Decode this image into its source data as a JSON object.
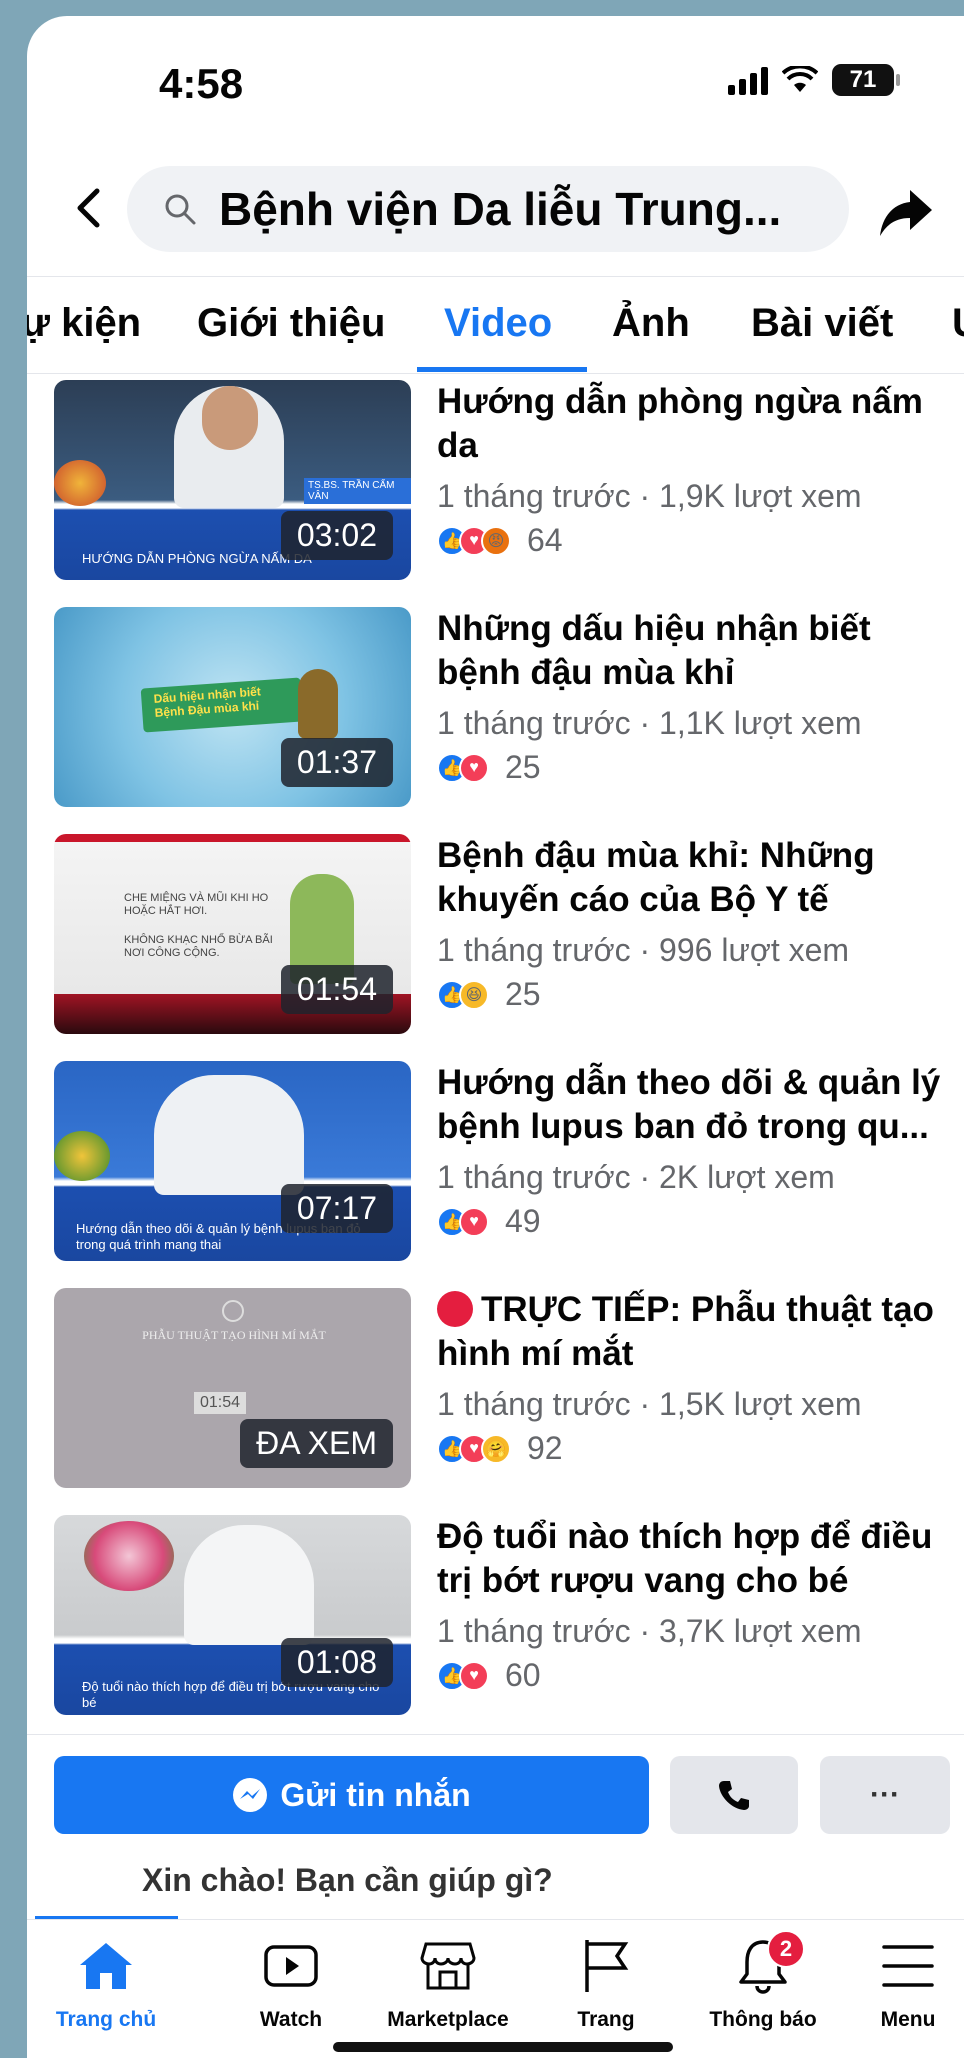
{
  "status": {
    "time": "4:58",
    "battery": "71"
  },
  "header": {
    "search_query": "Bệnh viện Da liễu Trung..."
  },
  "tabs": [
    {
      "label": "ự kiện"
    },
    {
      "label": "Giới thiệu"
    },
    {
      "label": "Video"
    },
    {
      "label": "Ảnh"
    },
    {
      "label": "Bài viết"
    },
    {
      "label": "U"
    }
  ],
  "videos": [
    {
      "title": "Hướng dẫn phòng ngừa nấm da",
      "meta": "1 tháng trước · 1,9K lượt xem",
      "reactions": "64",
      "duration": "03:02",
      "thumb_caption": "HƯỚNG DẪN PHÒNG NGỪA NẤM DA",
      "thumb_name_tag": "TS.BS. TRẦN CẨM VÂN"
    },
    {
      "title": "Những dấu hiệu nhận biết bệnh đậu mùa khỉ",
      "meta": "1 tháng trước · 1,1K lượt xem",
      "reactions": "25",
      "duration": "01:37",
      "thumb_caption": "Dấu hiệu nhận biết Bệnh Đậu mùa khỉ"
    },
    {
      "title": "Bệnh đậu mùa khỉ: Những khuyến cáo của Bộ Y tế",
      "meta": "1 tháng trước · 996 lượt xem",
      "reactions": "25",
      "duration": "01:54",
      "thumb_caption": "CHE MIỆNG VÀ MŨI KHI HO HOẶC HẮT HƠI.",
      "thumb_caption2": "KHÔNG KHẠC NHỔ BỪA BÃI NƠI CÔNG CỘNG."
    },
    {
      "title": "Hướng dẫn theo dõi & quản lý bệnh lupus ban đỏ trong qu...",
      "meta": "1 tháng trước · 2K lượt xem",
      "reactions": "49",
      "duration": "07:17",
      "thumb_caption": "Hướng dẫn theo dõi & quản lý bệnh lupus ban đỏ trong quá trình mang thai"
    },
    {
      "title": "TRỰC TIẾP: Phẫu thuật tạo hình mí mắt",
      "meta": "1 tháng trước · 1,5K lượt xem",
      "reactions": "92",
      "duration": "ĐA XEM",
      "thumb_caption": "PHẪU THUẬT TẠO HÌNH MÍ MẮT",
      "thumb_small_time": "01:54"
    },
    {
      "title": "Độ tuổi nào thích hợp để điều trị bớt rượu vang cho bé",
      "meta": "1 tháng trước · 3,7K lượt xem",
      "reactions": "60",
      "duration": "01:08",
      "thumb_caption": "Độ tuổi nào thích hợp để điều trị bớt rượu vang cho bé"
    }
  ],
  "actions": {
    "message_label": "Gửi tin nhắn",
    "more_label": "···",
    "greeting": "Xin chào! Bạn cần giúp gì?"
  },
  "bottom_nav": [
    {
      "label": "Trang chủ"
    },
    {
      "label": "Watch"
    },
    {
      "label": "Marketplace"
    },
    {
      "label": "Trang"
    },
    {
      "label": "Thông báo",
      "badge": "2"
    },
    {
      "label": "Menu"
    }
  ],
  "colors": {
    "accent": "#1877f2",
    "secondary_text": "#65676b",
    "badge": "#e41e3f",
    "frame": "#7fa6b7"
  }
}
